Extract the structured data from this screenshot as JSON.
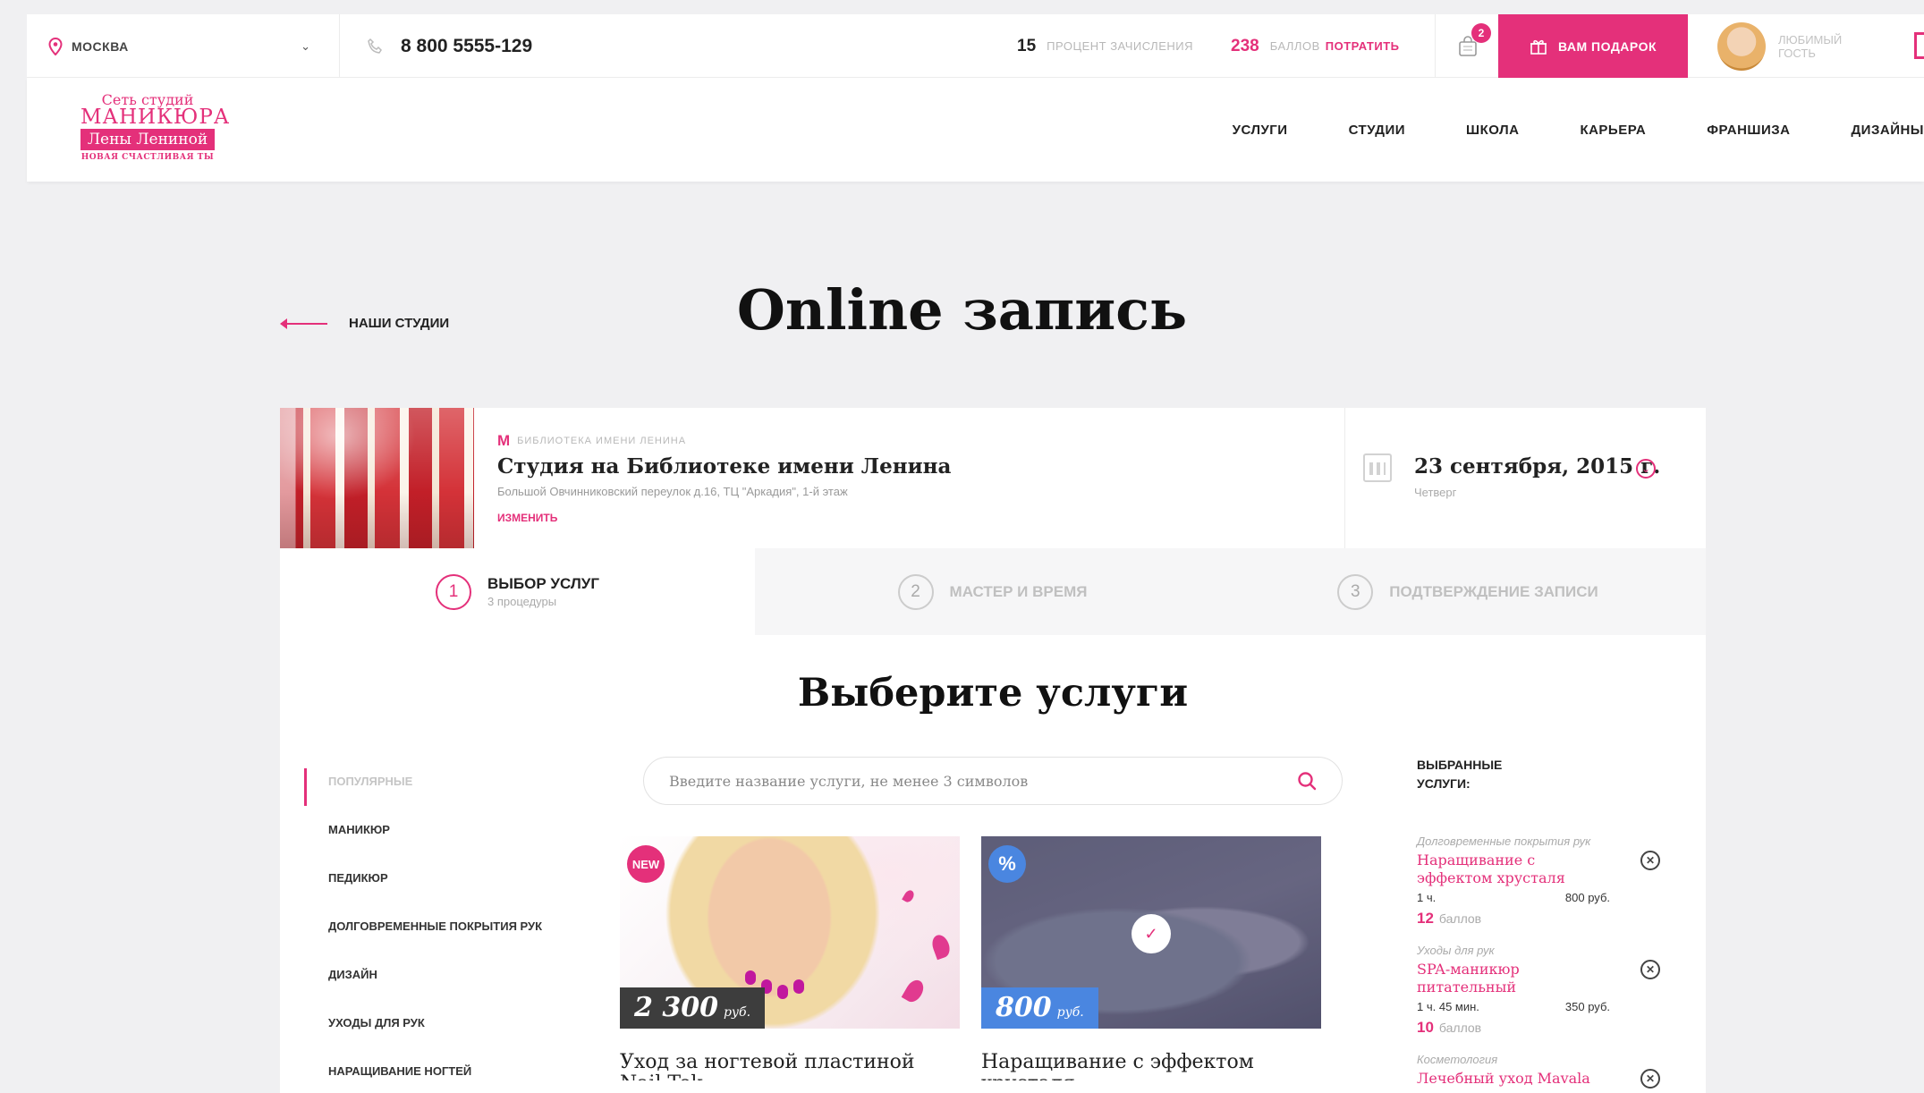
{
  "topbar": {
    "city": "МОСКВА",
    "phone": "8 800 5555-129",
    "percent_value": "15",
    "percent_label": "ПРОЦЕНТ ЗАЧИСЛЕНИЯ",
    "points_value": "238",
    "points_label": "БАЛЛОВ",
    "points_link": "ПОТРАТИТЬ",
    "bag_count": "2",
    "gift_label": "ВАМ ПОДАРОК",
    "user_label": "ЛЮБИМЫЙ ГОСТЬ"
  },
  "logo": {
    "line1": "Сеть студий",
    "line2": "МАНИКЮРА",
    "line3": "Лены Лениной",
    "tagline": "НОВАЯ СЧАСТЛИВАЯ ТЫ"
  },
  "nav": [
    "УСЛУГИ",
    "СТУДИИ",
    "ШКОЛА",
    "КАРЬЕРА",
    "ФРАНШИЗА",
    "ДИЗАЙНЫ"
  ],
  "page": {
    "back_label": "НАШИ СТУДИИ",
    "title": "Online запись"
  },
  "studio": {
    "metro": "БИБЛИОТЕКА ИМЕНИ ЛЕНИНА",
    "name": "Студия на Библиотеке имени Ленина",
    "address": "Большой Овчинниковский переулок д.16, ТЦ \"Аркадия\", 1-й этаж",
    "change_label": "ИЗМЕНИТЬ",
    "date": "23 сентября, 2015 г.",
    "weekday": "Четверг"
  },
  "steps": [
    {
      "num": "1",
      "title": "ВЫБОР УСЛУГ",
      "sub": "3 процедуры"
    },
    {
      "num": "2",
      "title": "МАСТЕР И ВРЕМЯ"
    },
    {
      "num": "3",
      "title": "ПОДТВЕРЖДЕНИЕ ЗАПИСИ"
    }
  ],
  "services": {
    "title": "Выберите услуги",
    "search_placeholder": "Введите название услуги, не менее 3 символов",
    "categories": [
      "ПОПУЛЯРНЫЕ",
      "МАНИКЮР",
      "ПЕДИКЮР",
      "ДОЛГОВРЕМЕННЫЕ ПОКРЫТИЯ РУК",
      "ДИЗАЙН",
      "УХОДЫ ДЛЯ РУК",
      "НАРАЩИВАНИЕ НОГТЕЙ"
    ],
    "cards": [
      {
        "badge": "NEW",
        "price": "2 300",
        "currency": "руб.",
        "name": "Уход за ногтевой пластиной Nail Tek"
      },
      {
        "badge": "%",
        "check": "✓",
        "price": "800",
        "currency": "руб.",
        "name": "Наращивание с эффектом хрусталя"
      }
    ]
  },
  "selected": {
    "heading_1": "ВЫБРАННЫЕ",
    "heading_2": "УСЛУГИ:",
    "items": [
      {
        "category": "Долговременные покрытия рук",
        "name": "Наращивание с эффектом хрусталя",
        "duration": "1 ч.",
        "price": "800 руб.",
        "points": "12",
        "points_label": "баллов"
      },
      {
        "category": "Уходы для рук",
        "name": "SPA-маникюр питательный",
        "duration": "1 ч. 45 мин.",
        "price": "350 руб.",
        "points": "10",
        "points_label": "баллов"
      },
      {
        "category": "Косметология",
        "name": "Лечебный уход Mavala"
      }
    ]
  },
  "colors": {
    "accent": "#e4307a",
    "promo_blue": "#4a86e0"
  }
}
